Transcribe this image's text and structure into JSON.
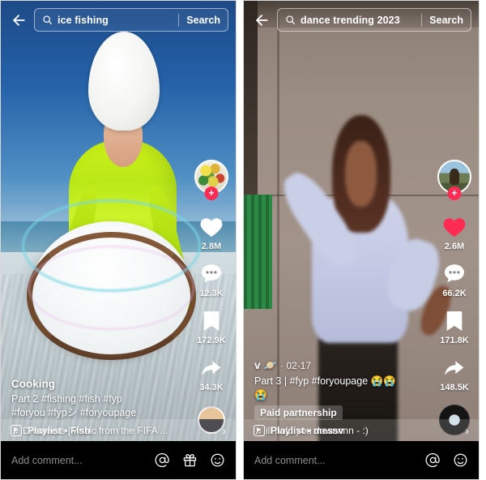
{
  "app": {
    "name": "TikTok",
    "screens": 2
  },
  "panels": [
    {
      "id": "left",
      "search": {
        "query": "ice fishing",
        "placeholder": "Search",
        "button_label": "Search",
        "back_icon": "back-arrow-icon",
        "search_icon": "search-icon"
      },
      "video": {
        "scene": "person in lime green jacket and white fur hat on frozen lake with spinning wooden-rim ice disc",
        "avatar_image": "fruit-platter-avatar"
      },
      "actions": {
        "follow_badge": "+",
        "like": {
          "icon": "heart-icon",
          "count": "2.8M",
          "liked": false
        },
        "comment": {
          "icon": "comment-icon",
          "count": "12.3K"
        },
        "bookmark": {
          "icon": "bookmark-icon",
          "count": "172.9K"
        },
        "share": {
          "icon": "share-arrow-icon",
          "count": "34.3K"
        }
      },
      "caption": {
        "username": "Cooking",
        "date": "",
        "line1": "Part 2  #fishing #fish #fyp",
        "line2": "#foryou #fypシ #foryoupage",
        "paid_partnership": "",
        "music_icon": "music-note-icon",
        "music": "Dreamers [Music from the FIFA ..."
      },
      "playlist": {
        "icon": "playlist-icon",
        "label": "Playlist • Fish",
        "chevron": "›"
      },
      "comment_bar": {
        "placeholder": "Add comment...",
        "icons": [
          "at-icon",
          "gift-icon",
          "emoji-icon"
        ]
      }
    },
    {
      "id": "right",
      "search": {
        "query": "dance trending 2023",
        "placeholder": "Search",
        "button_label": "Search",
        "back_icon": "back-arrow-icon",
        "search_icon": "search-icon"
      },
      "video": {
        "scene": "blurred person dancing in front of a beige concrete wall with green railing",
        "avatar_image": "outdoor-portrait-avatar"
      },
      "actions": {
        "follow_badge": "+",
        "like": {
          "icon": "heart-icon",
          "count": "2.6M",
          "liked": true
        },
        "comment": {
          "icon": "comment-icon",
          "count": "66.2K"
        },
        "bookmark": {
          "icon": "bookmark-icon",
          "count": "171.8K"
        },
        "share": {
          "icon": "share-arrow-icon",
          "count": "148.5K"
        },
        "music_disc": "spinning-record-icon"
      },
      "caption": {
        "username": "v 🪐",
        "date": "· 02-17",
        "line1": "Part 3 | #fyp #foryoupage 😭😭",
        "line2": "😭",
        "paid_partnership": "Paid partnership",
        "music_icon": "music-note-icon",
        "music": "ill hold you downnnn - :)"
      },
      "playlist": {
        "icon": "playlist-icon",
        "label": "Playlist • messv",
        "chevron": "›"
      },
      "comment_bar": {
        "placeholder": "Add comment...",
        "icons": [
          "at-icon",
          "emoji-icon"
        ]
      }
    }
  ],
  "colors": {
    "accent_red": "#fe2c55",
    "heart_liked": "#fe2c55",
    "bar_black": "#000000",
    "text_white": "#ffffff",
    "placeholder_gray": "#8d8d8d"
  }
}
